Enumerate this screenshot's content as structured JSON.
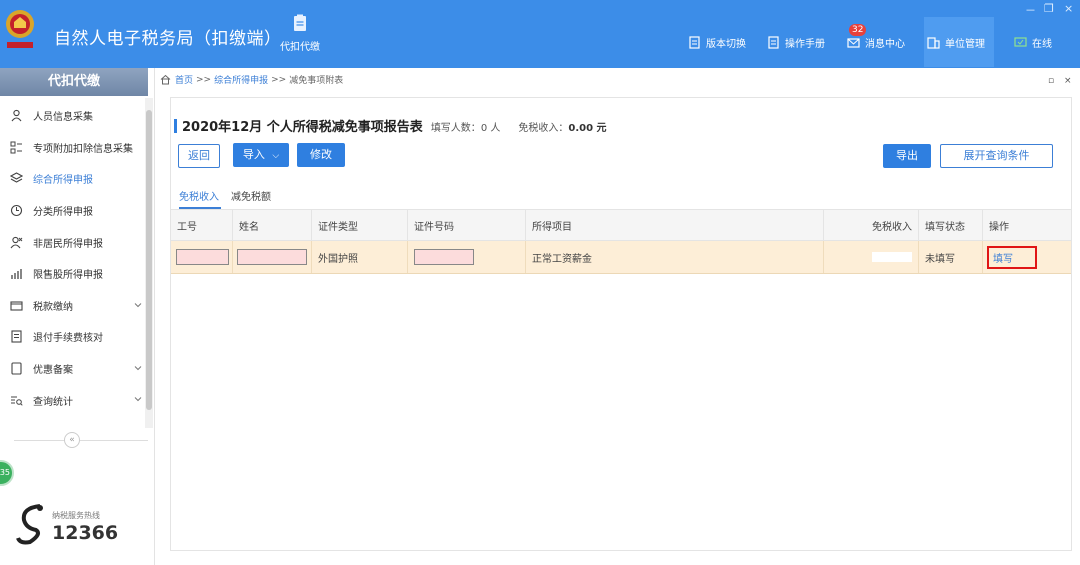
{
  "header": {
    "app_title": "自然人电子税务局（扣缴端）",
    "module_label": "代扣代缴",
    "nav": [
      {
        "label": "版本切换",
        "icon": "document-icon"
      },
      {
        "label": "操作手册",
        "icon": "book-icon"
      },
      {
        "label": "消息中心",
        "icon": "mail-icon",
        "badge": "32"
      },
      {
        "label": "单位管理",
        "icon": "building-icon"
      },
      {
        "label": "在线",
        "icon": "monitor-icon"
      }
    ],
    "window_controls": {
      "minimize": "－",
      "restore": "❐",
      "close": "×"
    }
  },
  "sidebar": {
    "title": "代扣代缴",
    "items": [
      {
        "label": "人员信息采集",
        "icon": "person-icon"
      },
      {
        "label": "专项附加扣除信息采集",
        "icon": "grid-list-icon"
      },
      {
        "label": "综合所得申报",
        "icon": "layers-icon",
        "active": true
      },
      {
        "label": "分类所得申报",
        "icon": "clock-icon"
      },
      {
        "label": "非居民所得申报",
        "icon": "person-x-icon"
      },
      {
        "label": "限售股所得申报",
        "icon": "bar-chart-icon"
      },
      {
        "label": "税款缴纳",
        "icon": "wallet-icon",
        "expandable": true
      },
      {
        "label": "退付手续费核对",
        "icon": "receipt-icon"
      },
      {
        "label": "优惠备案",
        "icon": "file-icon",
        "expandable": true
      },
      {
        "label": "查询统计",
        "icon": "search-list-icon",
        "expandable": true
      }
    ],
    "collapse_symbol": "«",
    "float_ball_text": "35",
    "hotline_label": "纳税服务热线",
    "hotline_number": "12366"
  },
  "breadcrumb": {
    "home": "首页",
    "sep": ">>",
    "level1": "综合所得申报",
    "current": "减免事项附表"
  },
  "tab_controls": {
    "restore": "▫",
    "close": "×"
  },
  "report": {
    "title": "2020年12月 个人所得税减免事项报告表",
    "filled_label": "填写人数：",
    "filled_value": "0 人",
    "exempt_label": "免税收入：",
    "exempt_value": "0.00 元"
  },
  "toolbar": {
    "back": "返回",
    "import": "导入",
    "modify": "修改",
    "export": "导出",
    "expand_query": "展开查询条件"
  },
  "sub_tabs": [
    {
      "label": "免税收入",
      "active": true
    },
    {
      "label": "减免税额",
      "active": false
    }
  ],
  "table": {
    "columns": [
      "工号",
      "姓名",
      "证件类型",
      "证件号码",
      "所得项目",
      "免税收入",
      "填写状态",
      "操作"
    ],
    "rows": [
      {
        "emp_id": "",
        "name": "",
        "id_type": "外国护照",
        "id_number": "",
        "income_item": "正常工资薪金",
        "exempt_income": "",
        "status": "未填写",
        "action": "填写"
      }
    ]
  },
  "colors": {
    "header_bg": "#3c8de8",
    "accent": "#2f7fe0",
    "row_highlight": "#fdeed7",
    "highlight_box": "#e01515"
  }
}
